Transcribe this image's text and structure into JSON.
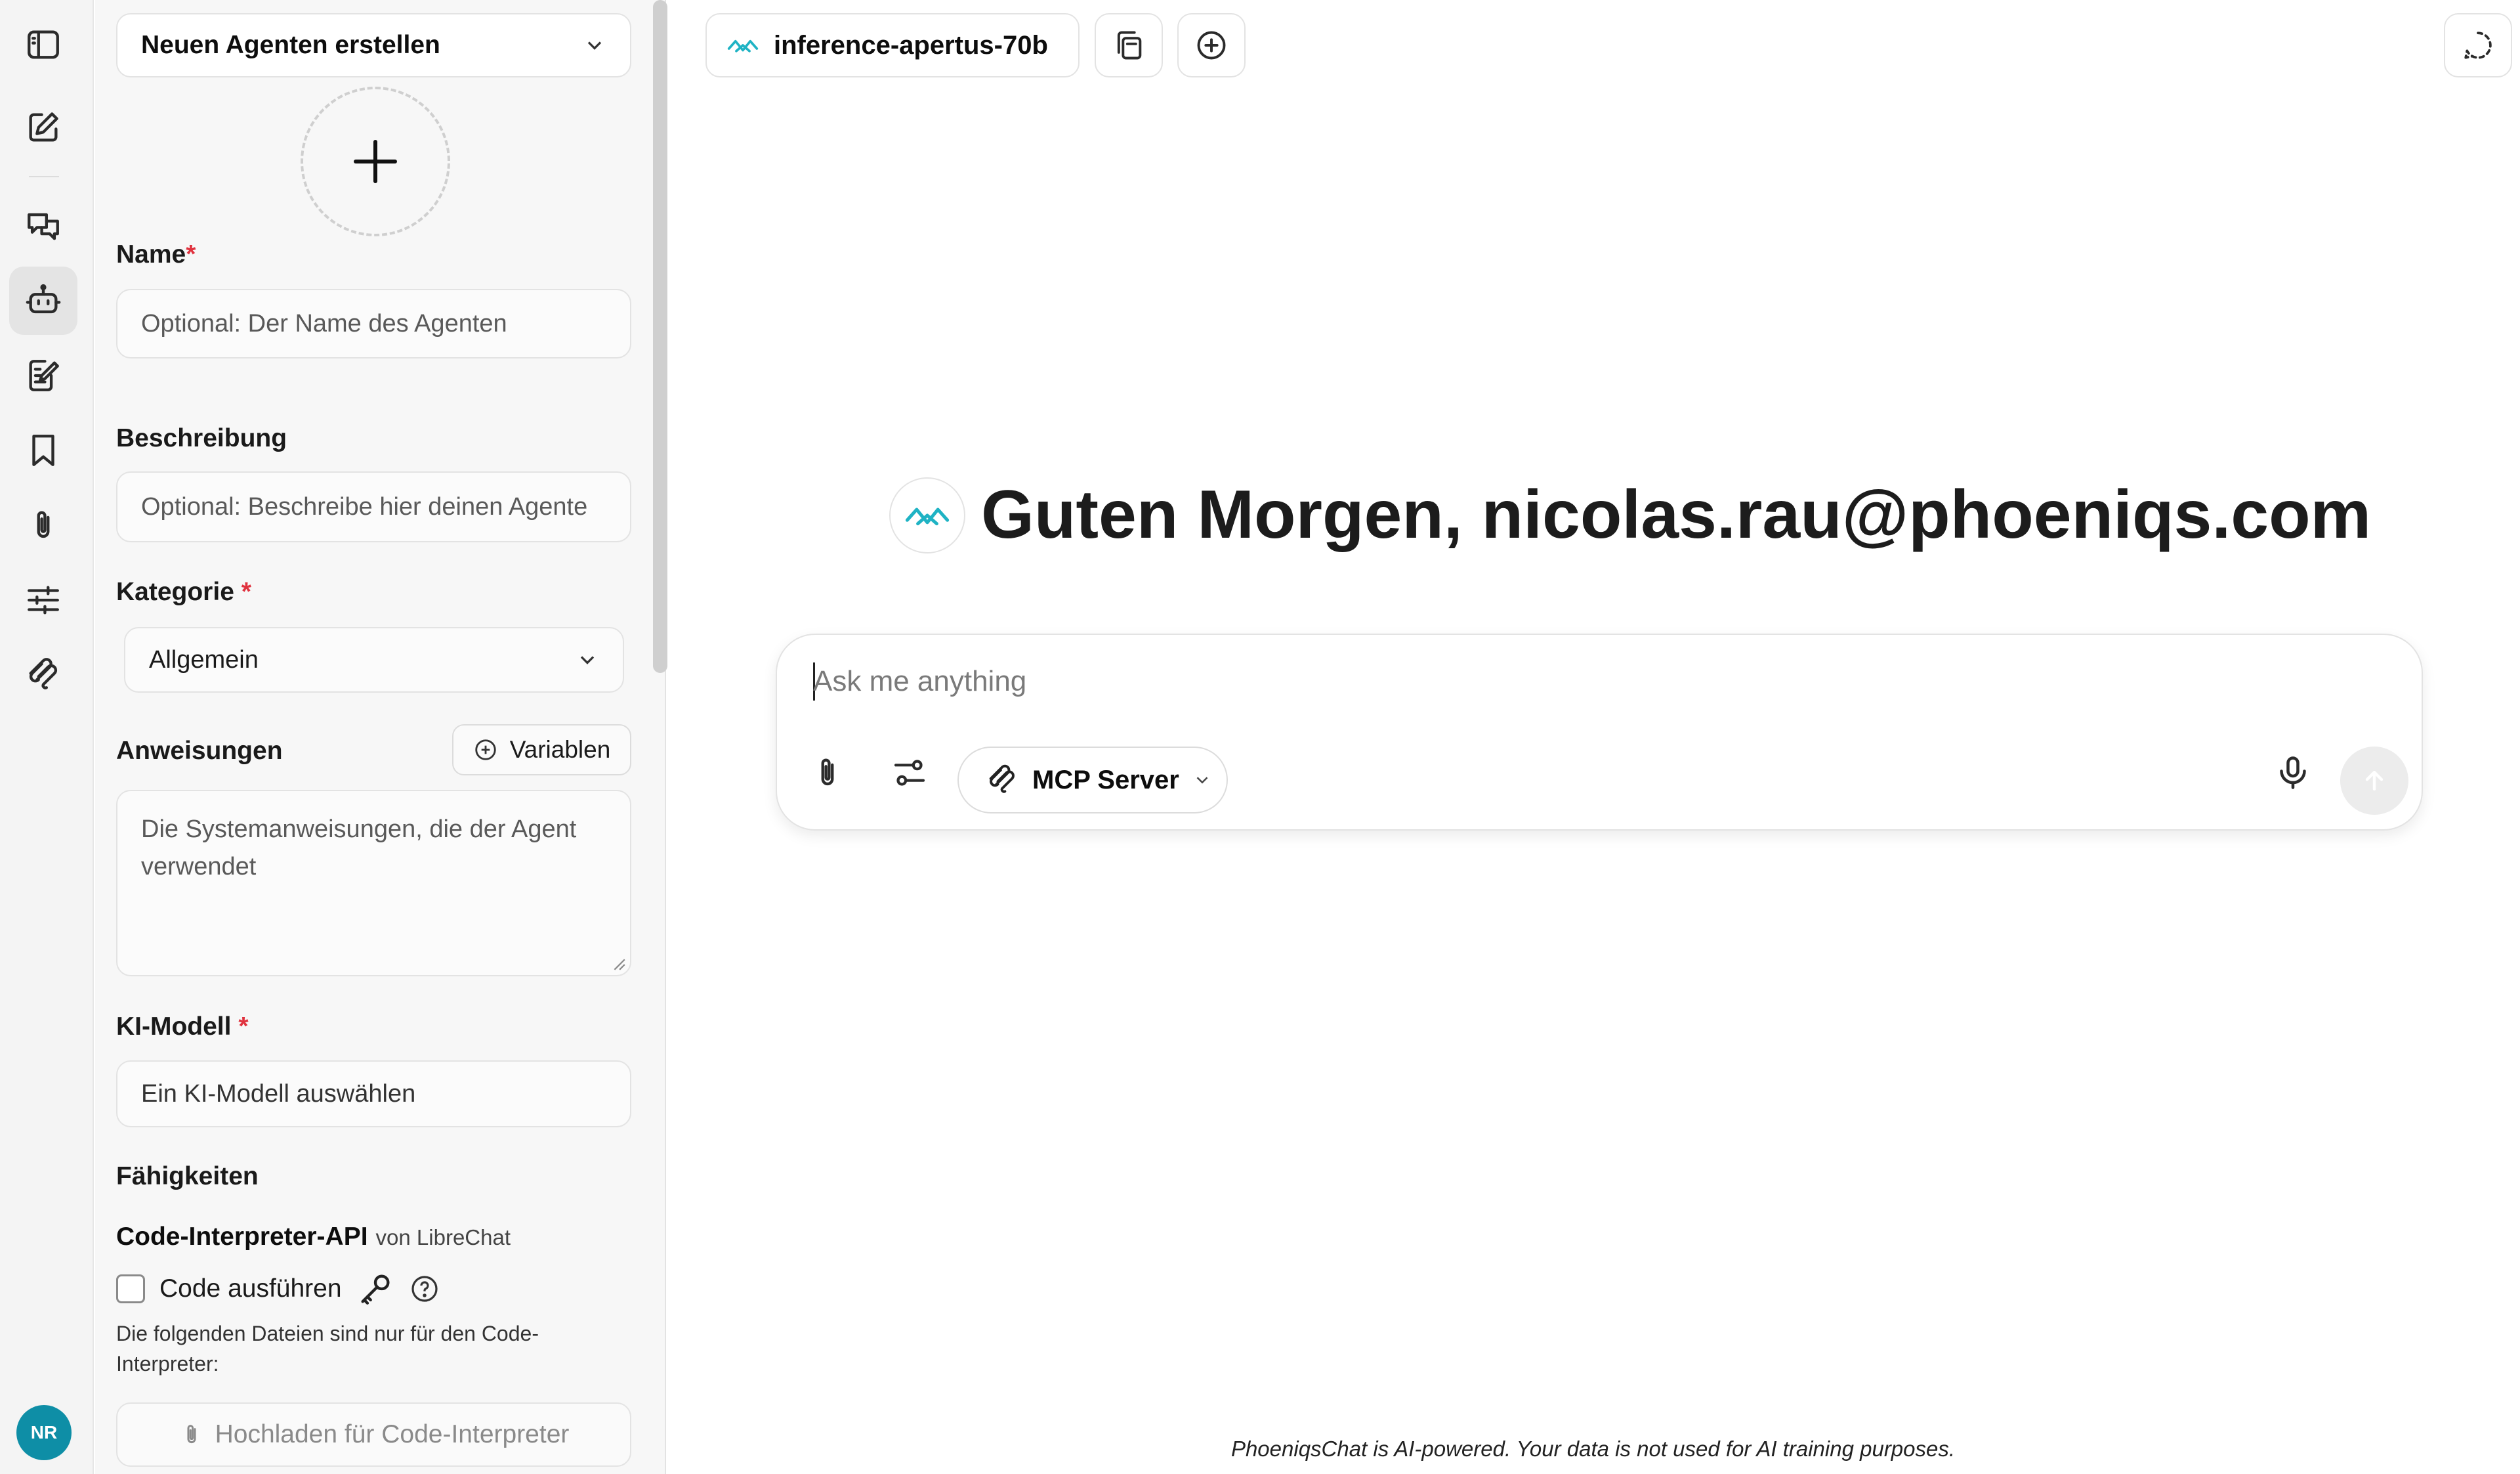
{
  "agent_panel": {
    "agent_select": "Neuen Agenten erstellen",
    "name_label": "Name",
    "name_placeholder": "Optional: Der Name des Agenten",
    "description_label": "Beschreibung",
    "description_placeholder": "Optional: Beschreibe hier deinen Agente",
    "category_label": "Kategorie",
    "category_value": "Allgemein",
    "instructions_label": "Anweisungen",
    "variables_button": "Variablen",
    "instructions_placeholder": "Die Systemanweisungen, die der Agent verwendet",
    "model_label": "KI-Modell",
    "model_placeholder": "Ein KI-Modell auswählen",
    "capabilities_label": "Fähigkeiten",
    "code_interpreter_title": "Code-Interpreter-API",
    "code_interpreter_by": "von LibreChat",
    "run_code_label": "Code ausführen",
    "files_note": "Die folgenden Dateien sind nur für den Code-Interpreter:",
    "upload_button": "Hochladen für Code-Interpreter",
    "required_marker": "*"
  },
  "user": {
    "initials": "NR"
  },
  "topbar": {
    "model_name": "inference-apertus-70b"
  },
  "main": {
    "greeting": "Guten Morgen, nicolas.rau@phoeniqs.com",
    "composer_placeholder": "Ask me anything",
    "mcp_label": "MCP Server",
    "footer": "PhoeniqsChat is AI-powered. Your data is not used for AI training purposes."
  },
  "icons": {
    "rail": [
      "sidebar-toggle-icon",
      "new-chat-icon",
      "conversations-icon",
      "agent-icon",
      "prompts-icon",
      "bookmark-icon",
      "attachments-icon",
      "parameters-icon",
      "mcp-icon"
    ],
    "top": [
      "model-logo-icon",
      "copy-conversation-icon",
      "add-chat-icon",
      "temporary-chat-icon"
    ]
  },
  "colors": {
    "accent": "#0e8ea6",
    "required": "#e0323e",
    "logo": "#1fb3c4"
  }
}
